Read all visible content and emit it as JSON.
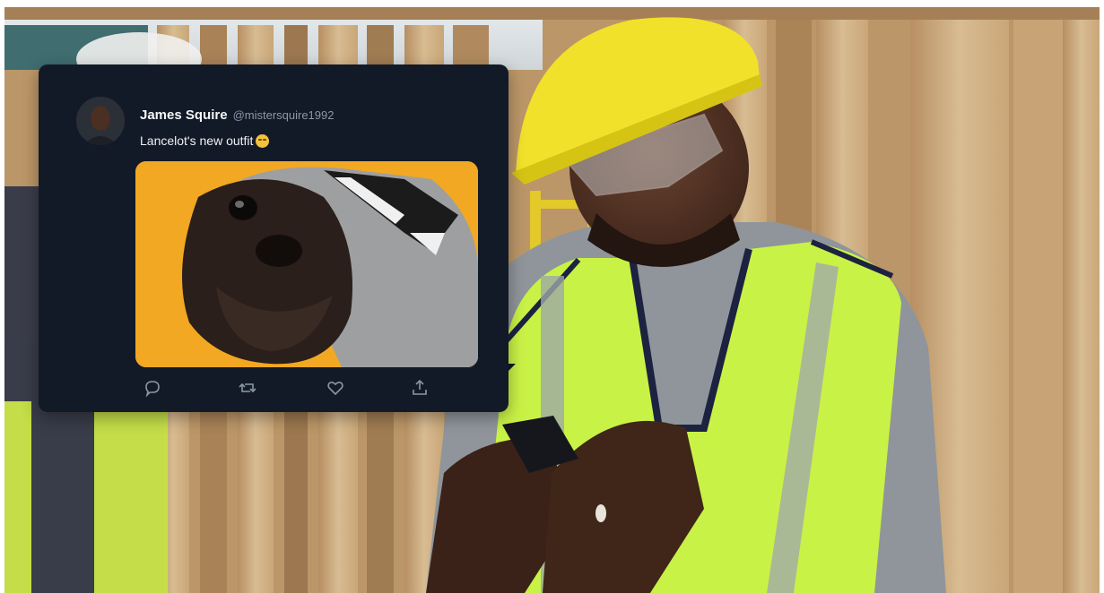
{
  "tweet": {
    "display_name": "James Squire",
    "handle": "@mistersquire1992",
    "text": "Lancelot's new outfit",
    "emoji_icon": "laughing-face-emoji",
    "actions": [
      {
        "name": "reply",
        "icon": "comment-icon"
      },
      {
        "name": "retweet",
        "icon": "retweet-icon"
      },
      {
        "name": "like",
        "icon": "heart-icon"
      },
      {
        "name": "share",
        "icon": "share-icon"
      }
    ]
  },
  "colors": {
    "card_background": "#131a27",
    "media_background": "#f2a823",
    "vest": "#c9f246",
    "hard_hat": "#f2e12a"
  }
}
